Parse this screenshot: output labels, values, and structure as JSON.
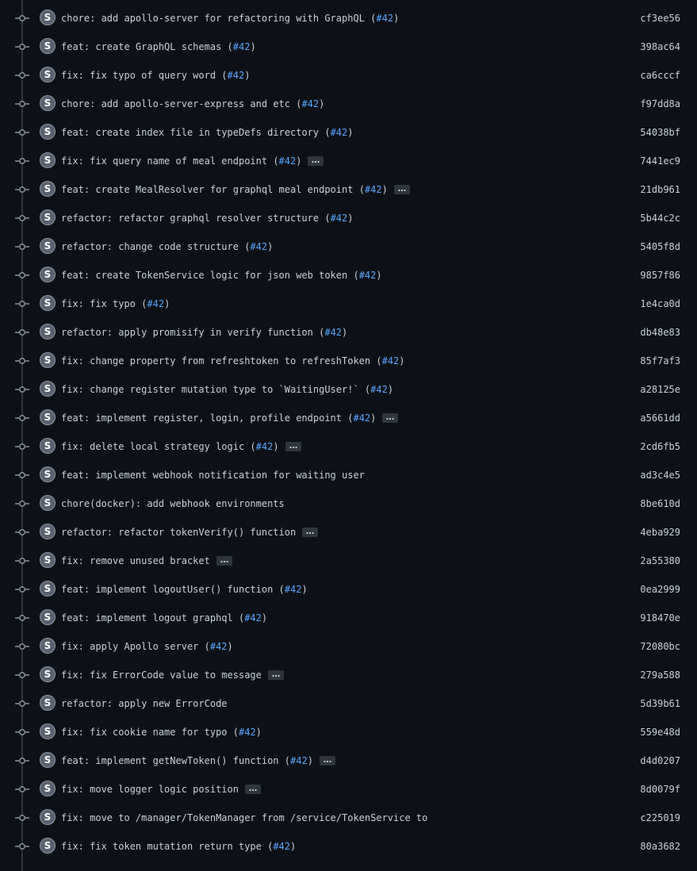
{
  "commits": [
    {
      "prefix": "chore: add apollo-server for refactoring with GraphQL ",
      "pr": "#42",
      "sha": "cf3ee56",
      "ellipsis": false
    },
    {
      "prefix": "feat: create GraphQL schemas ",
      "pr": "#42",
      "sha": "398ac64",
      "ellipsis": false
    },
    {
      "prefix": "fix: fix typo of query word ",
      "pr": "#42",
      "sha": "ca6cccf",
      "ellipsis": false
    },
    {
      "prefix": "chore: add apollo-server-express and etc ",
      "pr": "#42",
      "sha": "f97dd8a",
      "ellipsis": false
    },
    {
      "prefix": "feat: create index file in typeDefs directory ",
      "pr": "#42",
      "sha": "54038bf",
      "ellipsis": false
    },
    {
      "prefix": "fix: fix query name of meal endpoint ",
      "pr": "#42",
      "sha": "7441ec9",
      "ellipsis": true
    },
    {
      "prefix": "feat: create MealResolver for graphql meal endpoint ",
      "pr": "#42",
      "sha": "21db961",
      "ellipsis": true
    },
    {
      "prefix": "refactor: refactor graphql resolver structure ",
      "pr": "#42",
      "sha": "5b44c2c",
      "ellipsis": false
    },
    {
      "prefix": "refactor: change code structure ",
      "pr": "#42",
      "sha": "5405f8d",
      "ellipsis": false
    },
    {
      "prefix": "feat: create TokenService logic for json web token ",
      "pr": "#42",
      "sha": "9857f86",
      "ellipsis": false
    },
    {
      "prefix": "fix: fix typo ",
      "pr": "#42",
      "sha": "1e4ca0d",
      "ellipsis": false
    },
    {
      "prefix": "refactor: apply promisify in verify function ",
      "pr": "#42",
      "sha": "db48e83",
      "ellipsis": false
    },
    {
      "prefix": "fix: change property from refreshtoken to refreshToken ",
      "pr": "#42",
      "sha": "85f7af3",
      "ellipsis": false
    },
    {
      "prefix": "fix: change register mutation type to `WaitingUser!` ",
      "pr": "#42",
      "sha": "a28125e",
      "ellipsis": false
    },
    {
      "prefix": "feat: implement register, login, profile endpoint ",
      "pr": "#42",
      "sha": "a5661dd",
      "ellipsis": true
    },
    {
      "prefix": "fix: delete local strategy logic ",
      "pr": "#42",
      "sha": "2cd6fb5",
      "ellipsis": true
    },
    {
      "prefix": "feat: implement webhook notification for waiting user",
      "pr": "",
      "sha": "ad3c4e5",
      "ellipsis": false
    },
    {
      "prefix": "chore(docker): add webhook environments",
      "pr": "",
      "sha": "8be610d",
      "ellipsis": false
    },
    {
      "prefix": "refactor: refactor tokenVerify() function",
      "pr": "",
      "sha": "4eba929",
      "ellipsis": true
    },
    {
      "prefix": "fix: remove unused bracket",
      "pr": "",
      "sha": "2a55380",
      "ellipsis": true
    },
    {
      "prefix": "feat: implement logoutUser() function ",
      "pr": "#42",
      "sha": "0ea2999",
      "ellipsis": false
    },
    {
      "prefix": "feat: implement logout graphql ",
      "pr": "#42",
      "sha": "918470e",
      "ellipsis": false
    },
    {
      "prefix": "fix: apply Apollo server ",
      "pr": "#42",
      "sha": "72080bc",
      "ellipsis": false
    },
    {
      "prefix": "fix: fix ErrorCode value to message",
      "pr": "",
      "sha": "279a588",
      "ellipsis": true
    },
    {
      "prefix": "refactor: apply new ErrorCode",
      "pr": "",
      "sha": "5d39b61",
      "ellipsis": false
    },
    {
      "prefix": "fix: fix cookie name for typo ",
      "pr": "#42",
      "sha": "559e48d",
      "ellipsis": false
    },
    {
      "prefix": "feat: implement getNewToken() function ",
      "pr": "#42",
      "sha": "d4d0207",
      "ellipsis": true
    },
    {
      "prefix": "fix: move logger logic position",
      "pr": "",
      "sha": "8d0079f",
      "ellipsis": true
    },
    {
      "prefix": "fix: move to /manager/TokenManager from /service/TokenService to",
      "pr": "",
      "sha": "c225019",
      "ellipsis": false
    },
    {
      "prefix": "fix: fix token mutation return type ",
      "pr": "#42",
      "sha": "80a3682",
      "ellipsis": false
    }
  ],
  "avatar_letter": "S",
  "icons": {
    "node": "git-commit-icon",
    "avatar": "avatar",
    "more": "kebab-horizontal-icon"
  },
  "colors": {
    "background": "#0d1117",
    "text": "#c9d1d9",
    "link": "#58a6ff",
    "timeline": "#30363d",
    "node": "#8b949e"
  }
}
